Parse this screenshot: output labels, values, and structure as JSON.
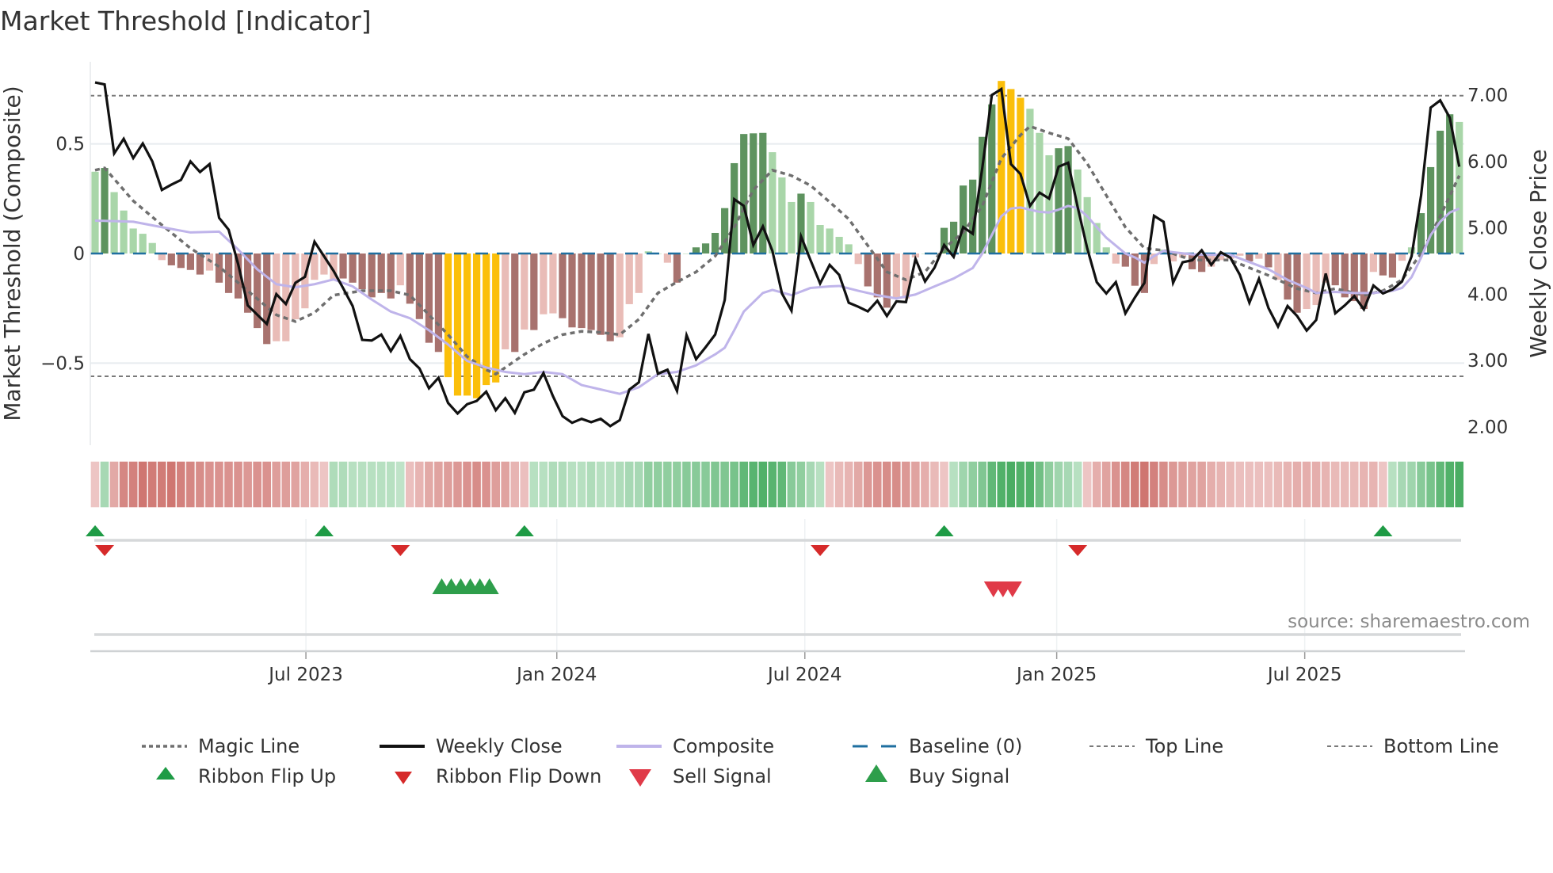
{
  "title": "Market Threshold [Indicator]",
  "source": "source: sharemaestro.com",
  "colors": {
    "bar_light_green": "#a9d6a9",
    "bar_dark_green": "#5e935f",
    "bar_light_red": "#e9bcb7",
    "bar_dark_red": "#a8726e",
    "bar_yellow": "#fbbf0a",
    "close": "#111111",
    "composite": "#bfb4ea",
    "magic": "#6f6f6f",
    "baseline": "#1f6fa0",
    "threshold": "#7a7a7a",
    "flip_up": "#1e9b45",
    "flip_down": "#d62a2a",
    "buy": "#2e9e4b",
    "sell": "#e03a48",
    "ribbon_green": "#3aa655",
    "ribbon_red": "#c8655f"
  },
  "chart_data": {
    "type": "bar+line",
    "title": "Market Threshold [Indicator]",
    "ylabel": "Market Threshold (Composite)",
    "ylabel_right": "Weekly Close Price",
    "ylim": [
      -0.88,
      0.87
    ],
    "ylim_right": [
      1.55,
      7.85
    ],
    "yticks": [
      {
        "v": 0.5,
        "label": "0.5"
      },
      {
        "v": 0,
        "label": "0"
      },
      {
        "v": -0.5,
        "label": "−0.5"
      }
    ],
    "yticks_right": [
      {
        "v": 7,
        "label": "7.00"
      },
      {
        "v": 6,
        "label": "6.00"
      },
      {
        "v": 5,
        "label": "5.00"
      },
      {
        "v": 4,
        "label": "4.00"
      },
      {
        "v": 3,
        "label": "3.00"
      },
      {
        "v": 2,
        "label": "2.00"
      }
    ],
    "xticks": [
      {
        "week": 22.1,
        "label": "Jul 2023"
      },
      {
        "week": 48.4,
        "label": "Jan 2024"
      },
      {
        "week": 74.4,
        "label": "Jul 2024"
      },
      {
        "week": 100.8,
        "label": "Jan 2025"
      },
      {
        "week": 126.8,
        "label": "Jul 2025"
      }
    ],
    "top_line": 0.72,
    "bottom_line": -0.56,
    "baseline": 0,
    "composite_bars": [
      0.373,
      0.39,
      0.28,
      0.196,
      0.114,
      0.09,
      0.048,
      -0.03,
      -0.054,
      -0.066,
      -0.075,
      -0.096,
      -0.078,
      -0.133,
      -0.18,
      -0.205,
      -0.27,
      -0.34,
      -0.413,
      -0.4,
      -0.4,
      -0.3,
      -0.25,
      -0.12,
      -0.096,
      -0.12,
      -0.114,
      -0.133,
      -0.163,
      -0.2,
      -0.18,
      -0.205,
      -0.145,
      -0.229,
      -0.299,
      -0.407,
      -0.449,
      -0.564,
      -0.648,
      -0.648,
      -0.66,
      -0.6,
      -0.588,
      -0.437,
      -0.449,
      -0.347,
      -0.349,
      -0.277,
      -0.273,
      -0.295,
      -0.337,
      -0.34,
      -0.349,
      -0.371,
      -0.4,
      -0.382,
      -0.231,
      -0.18,
      0.01,
      0,
      -0.042,
      -0.133,
      0,
      0.028,
      0.046,
      0.094,
      0.207,
      0.412,
      0.545,
      0.548,
      0.55,
      0.462,
      0.347,
      0.235,
      0.273,
      0.235,
      0.13,
      0.114,
      0.076,
      0.042,
      -0.048,
      -0.15,
      -0.2,
      -0.247,
      -0.205,
      -0.205,
      -0.018,
      0,
      0,
      0.117,
      0.145,
      0.31,
      0.337,
      0.532,
      0.68,
      0.787,
      0.75,
      0.71,
      0.66,
      0.55,
      0.448,
      0.48,
      0.49,
      0.383,
      0.257,
      0.139,
      0.028,
      -0.046,
      -0.06,
      -0.147,
      -0.18,
      -0.048,
      0.018,
      -0.036,
      -0.018,
      -0.072,
      -0.084,
      -0.06,
      -0.03,
      -0.024,
      -0.01,
      -0.036,
      -0.024,
      -0.063,
      -0.12,
      -0.21,
      -0.27,
      -0.253,
      -0.235,
      -0.133,
      -0.145,
      -0.2,
      -0.217,
      -0.253,
      -0.084,
      -0.1,
      -0.11,
      -0.033,
      0.028,
      0.184,
      0.394,
      0.56,
      0.635,
      0.6
    ],
    "bar_color_codes": "gGgggggrRRRRrRRRRRRrrrrrrrRRRRRRrRRRRYYYYYYrRrRrrRRRRRRrrrggrRgGGGGGGGGgggGgggggrRRRrrrggGGGGGGYYYgggGGggggrRRRrgrrRRrrrrRrRrRRrrrRRRRrRRrgGGGGg",
    "weekly_close": [
      7.19,
      7.16,
      6.12,
      6.34,
      6.05,
      6.27,
      6.0,
      5.57,
      5.65,
      5.72,
      6.0,
      5.84,
      5.96,
      5.15,
      4.97,
      4.45,
      3.83,
      3.69,
      3.55,
      4.0,
      3.85,
      4.17,
      4.26,
      4.79,
      4.57,
      4.35,
      4.09,
      3.82,
      3.31,
      3.3,
      3.39,
      3.14,
      3.37,
      3.02,
      2.88,
      2.58,
      2.74,
      2.36,
      2.2,
      2.34,
      2.39,
      2.53,
      2.25,
      2.43,
      2.21,
      2.52,
      2.56,
      2.81,
      2.46,
      2.16,
      2.06,
      2.12,
      2.07,
      2.12,
      2.01,
      2.1,
      2.56,
      2.67,
      3.4,
      2.8,
      2.86,
      2.54,
      3.38,
      3.02,
      3.2,
      3.39,
      3.91,
      5.43,
      5.33,
      4.74,
      5.02,
      4.65,
      4.01,
      3.75,
      4.87,
      4.51,
      4.16,
      4.44,
      4.29,
      3.87,
      3.81,
      3.74,
      3.9,
      3.67,
      3.89,
      3.88,
      4.53,
      4.19,
      4.4,
      4.74,
      4.56,
      5.01,
      4.91,
      5.9,
      7.0,
      7.09,
      5.96,
      5.81,
      5.33,
      5.53,
      5.44,
      5.92,
      5.98,
      5.31,
      4.69,
      4.18,
      4.01,
      4.18,
      3.71,
      3.95,
      4.17,
      5.18,
      5.09,
      4.17,
      4.48,
      4.51,
      4.66,
      4.44,
      4.63,
      4.55,
      4.29,
      3.87,
      4.23,
      3.79,
      3.51,
      3.82,
      3.67,
      3.45,
      3.61,
      4.31,
      3.71,
      3.83,
      3.97,
      3.77,
      4.13,
      4.01,
      4.07,
      4.19,
      4.57,
      5.49,
      6.81,
      6.92,
      6.66,
      5.92
    ],
    "magic_line": [
      [
        0,
        0.38
      ],
      [
        1,
        0.39
      ],
      [
        4,
        0.24
      ],
      [
        7,
        0.13
      ],
      [
        10,
        0.024
      ],
      [
        13,
        -0.06
      ],
      [
        16,
        -0.17
      ],
      [
        19,
        -0.28
      ],
      [
        21,
        -0.31
      ],
      [
        23,
        -0.27
      ],
      [
        25,
        -0.19
      ],
      [
        28,
        -0.17
      ],
      [
        31,
        -0.17
      ],
      [
        33,
        -0.19
      ],
      [
        35,
        -0.28
      ],
      [
        37,
        -0.37
      ],
      [
        39,
        -0.47
      ],
      [
        41,
        -0.53
      ],
      [
        42,
        -0.55
      ],
      [
        43,
        -0.52
      ],
      [
        45,
        -0.46
      ],
      [
        47,
        -0.41
      ],
      [
        49,
        -0.37
      ],
      [
        51,
        -0.355
      ],
      [
        53,
        -0.36
      ],
      [
        55,
        -0.37
      ],
      [
        57,
        -0.3
      ],
      [
        59,
        -0.18
      ],
      [
        61,
        -0.13
      ],
      [
        63,
        -0.084
      ],
      [
        65,
        -0.012
      ],
      [
        67,
        0.12
      ],
      [
        69,
        0.29
      ],
      [
        71,
        0.38
      ],
      [
        73,
        0.355
      ],
      [
        75,
        0.31
      ],
      [
        77,
        0.235
      ],
      [
        79,
        0.157
      ],
      [
        81,
        0.036
      ],
      [
        83,
        -0.084
      ],
      [
        85,
        -0.12
      ],
      [
        87,
        -0.084
      ],
      [
        89,
        0.024
      ],
      [
        91,
        0.096
      ],
      [
        93,
        0.217
      ],
      [
        95,
        0.434
      ],
      [
        97,
        0.54
      ],
      [
        98,
        0.58
      ],
      [
        100,
        0.55
      ],
      [
        102,
        0.524
      ],
      [
        104,
        0.41
      ],
      [
        106,
        0.265
      ],
      [
        108,
        0.12
      ],
      [
        110,
        0.024
      ],
      [
        112,
        0.014
      ],
      [
        115,
        -0.03
      ],
      [
        119,
        -0.03
      ],
      [
        123,
        -0.1
      ],
      [
        126,
        -0.16
      ],
      [
        128,
        -0.18
      ],
      [
        130,
        -0.16
      ],
      [
        133,
        -0.19
      ],
      [
        135,
        -0.17
      ],
      [
        137,
        -0.12
      ],
      [
        139,
        0
      ],
      [
        141,
        0.17
      ],
      [
        143,
        0.355
      ]
    ],
    "composite_line": [
      [
        0,
        0.15
      ],
      [
        4,
        0.145
      ],
      [
        7,
        0.12
      ],
      [
        10,
        0.096
      ],
      [
        13,
        0.1
      ],
      [
        15,
        0.018
      ],
      [
        17,
        -0.072
      ],
      [
        19,
        -0.14
      ],
      [
        21,
        -0.154
      ],
      [
        23,
        -0.14
      ],
      [
        25,
        -0.118
      ],
      [
        27,
        -0.15
      ],
      [
        29,
        -0.21
      ],
      [
        31,
        -0.265
      ],
      [
        33,
        -0.295
      ],
      [
        35,
        -0.35
      ],
      [
        37,
        -0.415
      ],
      [
        39,
        -0.49
      ],
      [
        41,
        -0.52
      ],
      [
        43,
        -0.54
      ],
      [
        45,
        -0.55
      ],
      [
        47,
        -0.54
      ],
      [
        49,
        -0.55
      ],
      [
        51,
        -0.6
      ],
      [
        53,
        -0.62
      ],
      [
        55,
        -0.64
      ],
      [
        57,
        -0.61
      ],
      [
        59,
        -0.55
      ],
      [
        61,
        -0.54
      ],
      [
        63,
        -0.51
      ],
      [
        65,
        -0.46
      ],
      [
        66,
        -0.43
      ],
      [
        67,
        -0.35
      ],
      [
        68,
        -0.265
      ],
      [
        70,
        -0.18
      ],
      [
        71,
        -0.166
      ],
      [
        73,
        -0.19
      ],
      [
        75,
        -0.157
      ],
      [
        77,
        -0.15
      ],
      [
        78,
        -0.148
      ],
      [
        80,
        -0.17
      ],
      [
        82,
        -0.19
      ],
      [
        84,
        -0.205
      ],
      [
        86,
        -0.187
      ],
      [
        88,
        -0.15
      ],
      [
        90,
        -0.114
      ],
      [
        92,
        -0.066
      ],
      [
        93,
        0
      ],
      [
        94,
        0.084
      ],
      [
        95,
        0.17
      ],
      [
        96,
        0.205
      ],
      [
        97,
        0.21
      ],
      [
        99,
        0.19
      ],
      [
        100,
        0.187
      ],
      [
        101,
        0.2
      ],
      [
        102,
        0.217
      ],
      [
        103,
        0.207
      ],
      [
        104,
        0.17
      ],
      [
        105,
        0.12
      ],
      [
        106,
        0.072
      ],
      [
        107,
        0.036
      ],
      [
        108,
        0
      ],
      [
        109,
        -0.018
      ],
      [
        110,
        -0.042
      ],
      [
        111,
        -0.012
      ],
      [
        112,
        0.012
      ],
      [
        113,
        0.006
      ],
      [
        115,
        -0.004
      ],
      [
        117,
        -0.006
      ],
      [
        119,
        -0.006
      ],
      [
        121,
        -0.039
      ],
      [
        123,
        -0.072
      ],
      [
        125,
        -0.12
      ],
      [
        127,
        -0.157
      ],
      [
        128,
        -0.18
      ],
      [
        130,
        -0.175
      ],
      [
        132,
        -0.18
      ],
      [
        134,
        -0.18
      ],
      [
        136,
        -0.17
      ],
      [
        137,
        -0.157
      ],
      [
        138,
        -0.108
      ],
      [
        139,
        -0.018
      ],
      [
        140,
        0.084
      ],
      [
        141,
        0.145
      ],
      [
        142,
        0.187
      ],
      [
        143,
        0.205
      ]
    ],
    "ribbon": [
      -0.15,
      0.3,
      -0.4,
      -0.7,
      -0.75,
      -0.85,
      -0.8,
      -0.8,
      -0.85,
      -0.75,
      -0.7,
      -0.65,
      -0.6,
      -0.6,
      -0.6,
      -0.6,
      -0.55,
      -0.6,
      -0.6,
      -0.5,
      -0.5,
      -0.45,
      -0.35,
      -0.25,
      -0.15,
      0.25,
      0.25,
      0.2,
      0.2,
      0.2,
      0.2,
      0.2,
      0.15,
      -0.2,
      -0.3,
      -0.4,
      -0.45,
      -0.5,
      -0.55,
      -0.6,
      -0.65,
      -0.6,
      -0.5,
      -0.45,
      -0.3,
      -0.2,
      0.2,
      0.2,
      0.25,
      0.25,
      0.2,
      0.2,
      0.25,
      0.2,
      0.2,
      0.25,
      0.3,
      0.3,
      0.45,
      0.45,
      0.45,
      0.45,
      0.5,
      0.5,
      0.5,
      0.55,
      0.55,
      0.6,
      0.75,
      0.8,
      0.85,
      0.8,
      0.75,
      0.5,
      0.45,
      0.3,
      0.2,
      -0.15,
      -0.25,
      -0.3,
      -0.4,
      -0.55,
      -0.6,
      -0.65,
      -0.65,
      -0.55,
      -0.45,
      -0.35,
      -0.25,
      -0.15,
      0.2,
      0.35,
      0.45,
      0.55,
      0.75,
      0.85,
      0.9,
      0.85,
      0.85,
      0.65,
      0.45,
      0.35,
      0.3,
      0.2,
      -0.15,
      -0.35,
      -0.45,
      -0.6,
      -0.7,
      -0.8,
      -0.85,
      -0.75,
      -0.65,
      -0.55,
      -0.5,
      -0.45,
      -0.45,
      -0.35,
      -0.3,
      -0.25,
      -0.2,
      -0.2,
      -0.2,
      -0.2,
      -0.25,
      -0.3,
      -0.35,
      -0.35,
      -0.35,
      -0.3,
      -0.25,
      -0.25,
      -0.25,
      -0.3,
      -0.3,
      -0.15,
      0.2,
      0.3,
      0.35,
      0.5,
      0.6,
      0.75,
      0.85,
      0.9
    ],
    "ribbon_flip_up_weeks": [
      1,
      25,
      46,
      90,
      136
    ],
    "ribbon_flip_down_weeks": [
      2,
      33,
      77,
      104
    ],
    "buy_signal_weeks": [
      37,
      38,
      39,
      40,
      41,
      42
    ],
    "sell_signal_weeks": [
      95,
      96,
      97
    ],
    "legend": [
      {
        "key": "magic",
        "label": "Magic Line",
        "symbol": "dotted"
      },
      {
        "key": "close",
        "label": "Weekly Close",
        "symbol": "solid"
      },
      {
        "key": "composite",
        "label": "Composite",
        "symbol": "solid-light"
      },
      {
        "key": "baseline",
        "label": "Baseline (0)",
        "symbol": "dashed"
      },
      {
        "key": "top",
        "label": "Top Line",
        "symbol": "dashed-thin"
      },
      {
        "key": "bottom",
        "label": "Bottom Line",
        "symbol": "dashed-thin"
      },
      {
        "key": "flip_up",
        "label": "Ribbon Flip Up",
        "symbol": "triangle-up"
      },
      {
        "key": "flip_down",
        "label": "Ribbon Flip Down",
        "symbol": "triangle-down"
      },
      {
        "key": "sell",
        "label": "Sell Signal",
        "symbol": "triangle-down-large"
      },
      {
        "key": "buy",
        "label": "Buy Signal",
        "symbol": "triangle-up-large"
      }
    ],
    "legend_position": "bottom"
  }
}
